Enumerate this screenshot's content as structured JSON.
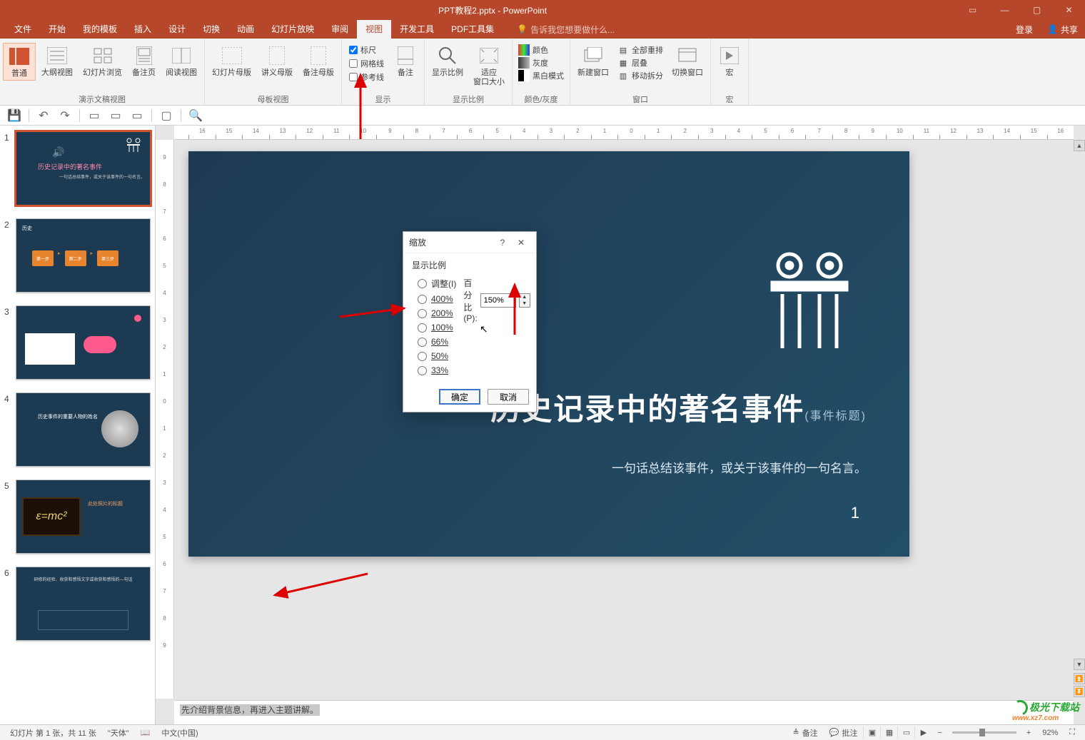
{
  "window": {
    "title": "PPT教程2.pptx - PowerPoint",
    "login": "登录",
    "share": "共享"
  },
  "tabs": {
    "file": "文件",
    "home": "开始",
    "template": "我的模板",
    "insert": "插入",
    "design": "设计",
    "transition": "切换",
    "animation": "动画",
    "slideshow": "幻灯片放映",
    "review": "审阅",
    "view": "视图",
    "devtools": "开发工具",
    "pdftools": "PDF工具集",
    "tellme": "告诉我您想要做什么..."
  },
  "ribbon": {
    "normal": "普通",
    "outline": "大纲视图",
    "sorter": "幻灯片浏览",
    "notes_page": "备注页",
    "reading": "阅读视图",
    "group_presentation": "演示文稿视图",
    "slide_master": "幻灯片母版",
    "handout_master": "讲义母版",
    "notes_master": "备注母版",
    "group_master": "母板视图",
    "ruler": "标尺",
    "gridlines": "网格线",
    "guides": "参考线",
    "group_show": "显示",
    "notes_btn": "备注",
    "zoom": "显示比例",
    "fit": "适应\n窗口大小",
    "group_zoom": "显示比例",
    "color": "颜色",
    "grayscale": "灰度",
    "bw": "黑白模式",
    "group_color": "颜色/灰度",
    "new_window": "新建窗口",
    "arrange_all": "全部重排",
    "cascade": "层叠",
    "move_split": "移动拆分",
    "group_window": "窗口",
    "switch_window": "切换窗口",
    "macros": "宏",
    "group_macros": "宏"
  },
  "ruler_h": [
    "16",
    "15",
    "14",
    "13",
    "12",
    "11",
    "10",
    "9",
    "8",
    "7",
    "6",
    "5",
    "4",
    "3",
    "2",
    "1",
    "0",
    "1",
    "2",
    "3",
    "4",
    "5",
    "6",
    "7",
    "8",
    "9",
    "10",
    "11",
    "12",
    "13",
    "14",
    "15",
    "16"
  ],
  "ruler_v": [
    "9",
    "8",
    "7",
    "6",
    "5",
    "4",
    "3",
    "2",
    "1",
    "0",
    "1",
    "2",
    "3",
    "4",
    "5",
    "6",
    "7",
    "8",
    "9"
  ],
  "thumbs": [
    {
      "num": "1",
      "title": "历史记录中的著名事件",
      "sub": "一句话总结事件，或关于该事件的一句名言。"
    },
    {
      "num": "2",
      "label": "历史"
    },
    {
      "num": "3"
    },
    {
      "num": "4",
      "label": "历史事件的重要人物的姓名"
    },
    {
      "num": "5",
      "formula": "ε=mc²",
      "label": "此处照片的标题"
    },
    {
      "num": "6"
    }
  ],
  "slide": {
    "title_partial": "记录中的著名事件",
    "title_suffix": "(事件标题)",
    "tagline": "一句话总结该事件，或关于该事件的一句名言。",
    "pagenum": "1"
  },
  "notes": "先介绍背景信息，再进入主题讲解。",
  "dialog": {
    "title": "缩放",
    "section": "显示比例",
    "fit_label": "调整(I)",
    "pct_label": "百分比(P):",
    "pct_value": "150%",
    "opts": {
      "o400": "400%",
      "o200": "200%",
      "o100": "100%",
      "o66": "66%",
      "o50": "50%",
      "o33": "33%"
    },
    "ok": "确定",
    "cancel": "取消"
  },
  "status": {
    "slide_info": "幻灯片 第 1 张，共 11 张",
    "theme": "\"天体\"",
    "lang": "中文(中国)",
    "notes": "备注",
    "comments": "批注",
    "zoom_pct": "92%"
  },
  "watermark": {
    "brand": "极光下载站",
    "url": "www.xz7.com"
  }
}
